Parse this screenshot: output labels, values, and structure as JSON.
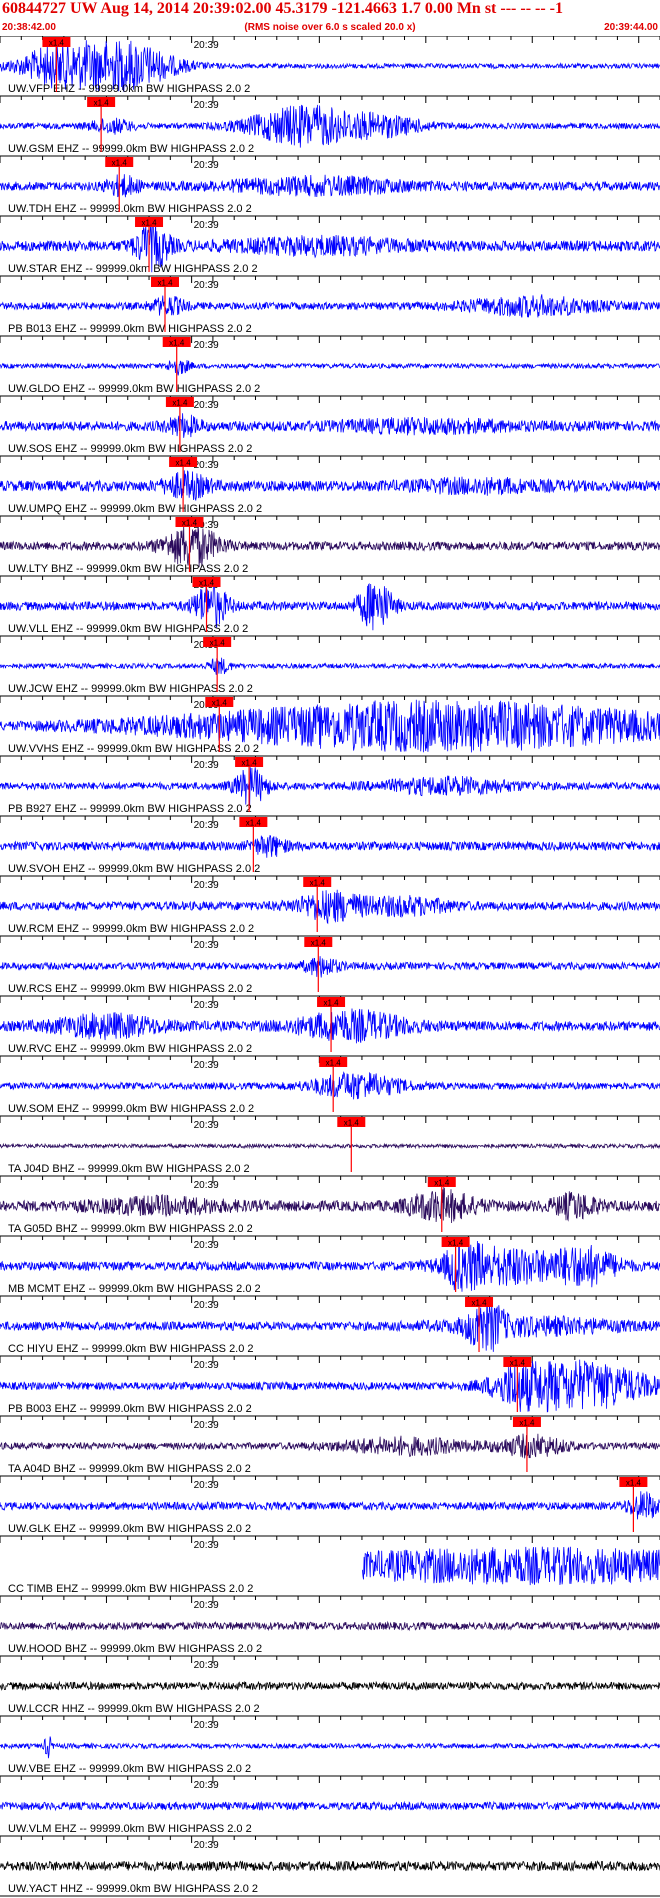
{
  "header": {
    "title": "60844727 UW Aug 14, 2014 20:39:02.00   45.3179 -121.4663  1.7 0.00 Mn st --- -- --   -1",
    "start_time": "20:38:42.00",
    "note": "(RMS noise over 6.0 s scaled 20.0 x)",
    "end_time": "20:39:44.00"
  },
  "chart_data": {
    "type": "line",
    "title": "60844727 UW Aug 14, 2014 20:39:02.00   45.3179 -121.4663  1.7 0.00 Mn st --- -- --   -1",
    "x_range": [
      "20:38:42.00",
      "20:39:44.00"
    ],
    "x_range_seconds": [
      0,
      62
    ],
    "minute_tick_label": "20:39",
    "minute_tick_second": 18,
    "pick_label": "x1.4",
    "colors": {
      "blue": "#0000ff",
      "dark": "#2a0a5c",
      "black": "#000000",
      "pick": "#ff0000",
      "header": "#e00000"
    },
    "series": [
      {
        "name": "UW.VFP EHZ -- 99999.0km BW  HIGHPASS  2.0  2",
        "pick_s": 5.3,
        "color": "blue",
        "noise": 0.1,
        "bursts": [
          [
            8.5,
            0.85,
            6.0
          ],
          [
            12.5,
            0.45,
            4.0
          ],
          [
            4.5,
            0.25,
            2.0
          ]
        ]
      },
      {
        "name": "UW.GSM EHZ -- 99999.0km BW  HIGHPASS  2.0  2",
        "pick_s": 9.5,
        "color": "blue",
        "noise": 0.12,
        "bursts": [
          [
            28.5,
            0.8,
            5.0
          ],
          [
            36.0,
            0.35,
            4.0
          ],
          [
            10.5,
            0.25,
            2.0
          ]
        ]
      },
      {
        "name": "UW.TDH EHZ -- 99999.0km BW  HIGHPASS  2.0  2",
        "pick_s": 11.2,
        "color": "blue",
        "noise": 0.18,
        "bursts": [
          [
            11.5,
            0.35,
            1.5
          ],
          [
            30.0,
            0.3,
            8.0
          ]
        ]
      },
      {
        "name": "UW.STAR EHZ -- 99999.0km BW  HIGHPASS  2.0  2",
        "pick_s": 14.0,
        "color": "blue",
        "noise": 0.22,
        "bursts": [
          [
            14.3,
            0.9,
            1.5
          ],
          [
            30.0,
            0.25,
            8.0
          ]
        ]
      },
      {
        "name": "PB B013 EHZ -- 99999.0km BW  HIGHPASS  2.0  2",
        "pick_s": 15.5,
        "color": "blue",
        "noise": 0.15,
        "bursts": [
          [
            15.8,
            0.35,
            1.5
          ],
          [
            50.0,
            0.35,
            6.0
          ]
        ]
      },
      {
        "name": "UW.GLDO EHZ -- 99999.0km BW  HIGHPASS  2.0  2",
        "pick_s": 16.6,
        "color": "blue",
        "noise": 0.1,
        "bursts": [
          [
            16.8,
            0.3,
            1.0
          ]
        ]
      },
      {
        "name": "UW.SOS EHZ -- 99999.0km BW  HIGHPASS  2.0  2",
        "pick_s": 16.9,
        "color": "blue",
        "noise": 0.2,
        "bursts": [
          [
            17.2,
            0.35,
            1.5
          ],
          [
            40.0,
            0.2,
            8.0
          ]
        ]
      },
      {
        "name": "UW.UMPQ EHZ -- 99999.0km BW  HIGHPASS  2.0  2",
        "pick_s": 17.2,
        "color": "blue",
        "noise": 0.22,
        "bursts": [
          [
            17.5,
            0.45,
            2.0
          ],
          [
            45.0,
            0.2,
            6.0
          ]
        ]
      },
      {
        "name": "UW.LTY BHZ -- 99999.0km BW  HIGHPASS  2.0  2",
        "pick_s": 17.8,
        "color": "dark",
        "noise": 0.18,
        "bursts": [
          [
            18.0,
            0.8,
            2.5
          ]
        ]
      },
      {
        "name": "UW.VLL EHZ -- 99999.0km BW  HIGHPASS  2.0  2",
        "pick_s": 19.4,
        "color": "blue",
        "noise": 0.18,
        "bursts": [
          [
            19.8,
            0.9,
            1.5
          ],
          [
            35.3,
            1.0,
            1.5
          ]
        ]
      },
      {
        "name": "UW.JCW EHZ -- 99999.0km BW  HIGHPASS  2.0  2",
        "pick_s": 20.4,
        "color": "blue",
        "noise": 0.1,
        "bursts": [
          [
            20.6,
            0.3,
            1.0
          ]
        ]
      },
      {
        "name": "UW.VVHS EHZ -- 99999.0km BW  HIGHPASS  2.0  2",
        "pick_s": 20.6,
        "color": "blue",
        "noise": 0.12,
        "bursts": [
          [
            41.0,
            1.0,
            25.0
          ]
        ]
      },
      {
        "name": "PB B927 EHZ -- 99999.0km BW  HIGHPASS  2.0  2",
        "pick_s": 23.4,
        "color": "blue",
        "noise": 0.15,
        "bursts": [
          [
            23.6,
            0.7,
            1.5
          ],
          [
            42.0,
            0.3,
            6.0
          ]
        ]
      },
      {
        "name": "UW.SVOH EHZ -- 99999.0km BW  HIGHPASS  2.0  2",
        "pick_s": 23.8,
        "color": "blue",
        "noise": 0.18,
        "bursts": [
          [
            25.3,
            0.35,
            1.5
          ]
        ]
      },
      {
        "name": "UW.RCM EHZ -- 99999.0km BW  HIGHPASS  2.0  2",
        "pick_s": 29.8,
        "color": "blue",
        "noise": 0.18,
        "bursts": [
          [
            31.0,
            0.55,
            3.0
          ],
          [
            38.0,
            0.3,
            4.0
          ]
        ]
      },
      {
        "name": "UW.RCS EHZ -- 99999.0km BW  HIGHPASS  2.0  2",
        "pick_s": 29.9,
        "color": "blue",
        "noise": 0.15,
        "bursts": [
          [
            30.2,
            0.35,
            1.5
          ]
        ]
      },
      {
        "name": "UW.RVC EHZ -- 99999.0km BW  HIGHPASS  2.0  2",
        "pick_s": 31.1,
        "color": "blue",
        "noise": 0.2,
        "bursts": [
          [
            10.0,
            0.4,
            5.0
          ],
          [
            33.0,
            0.55,
            5.0
          ]
        ]
      },
      {
        "name": "UW.SOM EHZ -- 99999.0km BW  HIGHPASS  2.0  2",
        "pick_s": 31.3,
        "color": "blue",
        "noise": 0.14,
        "bursts": [
          [
            33.5,
            0.5,
            4.0
          ]
        ]
      },
      {
        "name": "TA J04D BHZ -- 99999.0km BW  HIGHPASS  2.0  2",
        "pick_s": 33.0,
        "color": "dark",
        "noise": 0.08,
        "bursts": []
      },
      {
        "name": "TA G05D BHZ -- 99999.0km BW  HIGHPASS  2.0  2",
        "pick_s": 41.5,
        "color": "dark",
        "noise": 0.22,
        "bursts": [
          [
            41.5,
            0.55,
            3.0
          ],
          [
            54.0,
            0.45,
            2.0
          ],
          [
            15.0,
            0.25,
            6.0
          ]
        ]
      },
      {
        "name": "MB MCMT EHZ -- 99999.0km BW  HIGHPASS  2.0  2",
        "pick_s": 42.8,
        "color": "blue",
        "noise": 0.18,
        "bursts": [
          [
            43.6,
            0.9,
            1.5
          ],
          [
            47.5,
            0.7,
            5.0
          ],
          [
            55.0,
            0.7,
            3.0
          ]
        ]
      },
      {
        "name": "CC HIYU EHZ -- 99999.0km BW  HIGHPASS  2.0  2",
        "pick_s": 45.0,
        "color": "blue",
        "noise": 0.18,
        "bursts": [
          [
            45.6,
            1.0,
            1.5
          ],
          [
            50.0,
            0.3,
            8.0
          ]
        ]
      },
      {
        "name": "PB B003 EHZ -- 99999.0km BW  HIGHPASS  2.0  2",
        "pick_s": 48.6,
        "color": "blue",
        "noise": 0.16,
        "bursts": [
          [
            49.5,
            0.8,
            3.0
          ],
          [
            55.0,
            0.9,
            6.0
          ]
        ]
      },
      {
        "name": "TA A04D BHZ -- 99999.0km BW  HIGHPASS  2.0  2",
        "pick_s": 49.5,
        "color": "dark",
        "noise": 0.14,
        "bursts": [
          [
            50.0,
            0.4,
            3.0
          ],
          [
            38.0,
            0.3,
            6.0
          ]
        ]
      },
      {
        "name": "UW.GLK EHZ -- 99999.0km BW  HIGHPASS  2.0  2",
        "pick_s": 59.5,
        "color": "blue",
        "noise": 0.16,
        "bursts": [
          [
            60.5,
            0.5,
            1.5
          ]
        ]
      },
      {
        "name": "CC TIMB EHZ -- 99999.0km BW  HIGHPASS  2.0  2",
        "pick_s": null,
        "color": "blue",
        "noise": 0.02,
        "start_s": 34.0,
        "bursts": [
          [
            50.0,
            0.8,
            28.0
          ]
        ]
      },
      {
        "name": "UW.HOOD BHZ -- 99999.0km BW  HIGHPASS  2.0  2",
        "pick_s": null,
        "color": "dark",
        "noise": 0.16,
        "bursts": []
      },
      {
        "name": "UW.LCCR HHZ -- 99999.0km BW  HIGHPASS  2.0  2",
        "pick_s": null,
        "color": "black",
        "noise": 0.16,
        "bursts": []
      },
      {
        "name": "UW.VBE EHZ -- 99999.0km BW  HIGHPASS  2.0  2",
        "pick_s": null,
        "color": "blue",
        "noise": 0.1,
        "bursts": [
          [
            4.5,
            0.5,
            0.3
          ]
        ]
      },
      {
        "name": "UW.VLM EHZ -- 99999.0km BW  HIGHPASS  2.0  2",
        "pick_s": null,
        "color": "blue",
        "noise": 0.16,
        "bursts": []
      },
      {
        "name": "UW.YACT HHZ -- 99999.0km BW  HIGHPASS  2.0  2",
        "pick_s": null,
        "color": "black",
        "noise": 0.2,
        "bursts": []
      }
    ]
  }
}
